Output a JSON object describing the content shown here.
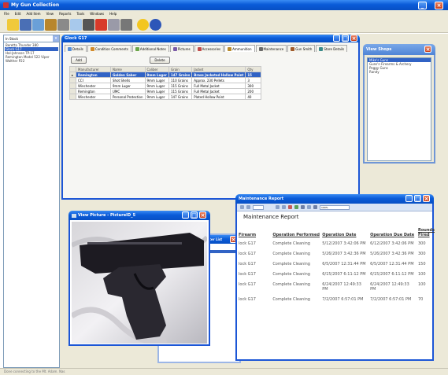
{
  "app": {
    "title": "My Gun Collection"
  },
  "menu": [
    "File",
    "Edit",
    "Add Item",
    "View",
    "Reports",
    "Tools",
    "Windows",
    "Help"
  ],
  "toolbar": [
    "open-icon",
    "save-icon",
    "chart-icon",
    "ammo-icon",
    "tools-icon",
    "search-icon",
    "gun-icon",
    "delete-icon",
    "report-icon",
    "scope-icon",
    "smiley-icon",
    "help-icon"
  ],
  "sidebar": {
    "filter": "In Stock",
    "items": [
      "Beretta Thunder 380",
      "Glock G17",
      "Hal-Johnson TP-17",
      "Remington Model 522 Viper",
      "Walther P22"
    ],
    "selected": 1
  },
  "stock": {
    "title": "Glock G17",
    "tabs": [
      "Details",
      "Condition Comments",
      "Additional Notes",
      "Pictures",
      "Accessories",
      "Ammunition",
      "Maintenance",
      "Gun Smith",
      "Store Details"
    ],
    "active_tab": 5,
    "add": "Add",
    "delete": "Delete",
    "columns": [
      "Manufacturer",
      "Name",
      "Caliber",
      "Grain",
      "Jacket",
      "Qty"
    ],
    "rows": [
      [
        "Remington",
        "Golden Saber",
        "9mm Luger",
        "147 Grains",
        "Brass Jacketed Hollow Point",
        "15"
      ],
      [
        "CCI",
        "Shot Shells",
        "9mm Luger",
        "110 Grains",
        "Approx. 230 Pellets",
        "3"
      ],
      [
        "Winchester",
        "9mm Luger",
        "9mm Luger",
        "115 Grains",
        "Full Metal Jacket",
        "300"
      ],
      [
        "Remington",
        "UMC",
        "9mm Luger",
        "115 Grains",
        "Full Metal Jacket",
        "200"
      ],
      [
        "Winchester",
        "Personal Protection",
        "9mm Luger",
        "147 Grains",
        "Plated Hollow Point",
        "40"
      ]
    ]
  },
  "shops": {
    "title": "View Shops",
    "items": [
      "Mike's Guns",
      "Guns'n Firearms & Archery",
      "Peggy Guns",
      "Randy"
    ]
  },
  "report": {
    "title": "Maintenance Report",
    "header": "Maintenance Report",
    "zoom": "100%",
    "columns": [
      "Firearm",
      "Operation Performed",
      "Operation Date",
      "Operation Due Date",
      "Rounds Fired"
    ],
    "rows": [
      [
        "lock G17",
        "Complete Cleaning",
        "5/12/2007 3:42:06 PM",
        "6/12/2007 3:42:06 PM",
        "300"
      ],
      [
        "lock G17",
        "Complete Cleaning",
        "5/26/2007 3:42:36 PM",
        "5/26/2007 3:42:36 PM",
        "300"
      ],
      [
        "lock G17",
        "Complete Cleaning",
        "6/5/2007 12:31:44 PM",
        "6/5/2007 12:31:44 PM",
        "150"
      ],
      [
        "lock G17",
        "Complete Cleaning",
        "6/15/2007 6:11:12 PM",
        "6/15/2007 6:11:12 PM",
        "100"
      ],
      [
        "lock G17",
        "Complete Cleaning",
        "6/24/2007 12:49:33 PM",
        "6/24/2007 12:49:33 PM",
        "100"
      ],
      [
        "lock G17",
        "Complete Cleaning",
        "7/2/2007 6:57:01 PM",
        "7/2/2007 6:57:01 PM",
        "70"
      ]
    ]
  },
  "picture": {
    "title": "View Picture - PictureID_5"
  },
  "hidden_window": {
    "title_fragment": "ter List"
  },
  "status": "Done connecting to the Mt. Adam. Nas"
}
